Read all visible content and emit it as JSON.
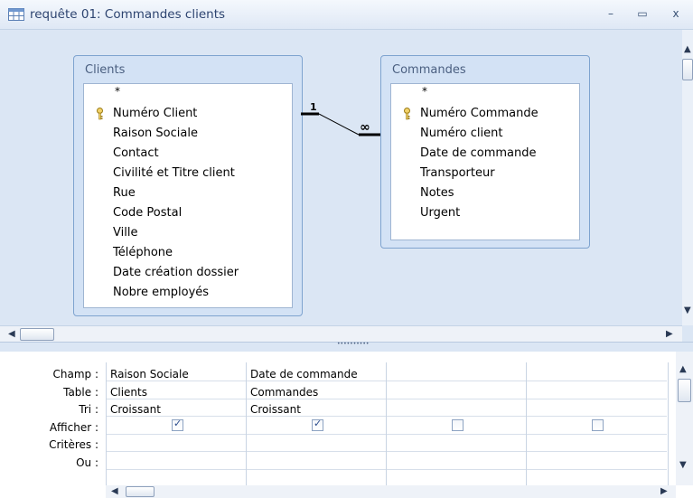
{
  "window": {
    "title": "requête 01: Commandes clients",
    "minimize": "–",
    "maximize": "▭",
    "close": "x"
  },
  "tables": {
    "clients": {
      "title": "Clients",
      "star": "*",
      "fields": [
        "Numéro Client",
        "Raison Sociale",
        "Contact",
        "Civilité et Titre client",
        "Rue",
        "Code Postal",
        "Ville",
        "Téléphone",
        "Date création dossier",
        "Nobre employés"
      ]
    },
    "commandes": {
      "title": "Commandes",
      "star": "*",
      "fields": [
        "Numéro Commande",
        "Numéro client",
        "Date de commande",
        "Transporteur",
        "Notes",
        "Urgent"
      ]
    }
  },
  "relationship": {
    "one": "1",
    "many": "∞"
  },
  "grid": {
    "row_labels": [
      "Champ :",
      "Table :",
      "Tri :",
      "Afficher :",
      "Critères :",
      "Ou :"
    ],
    "columns": [
      {
        "champ": "Raison Sociale",
        "table": "Clients",
        "tri": "Croissant",
        "afficher": true
      },
      {
        "champ": "Date de commande",
        "table": "Commandes",
        "tri": "Croissant",
        "afficher": true
      },
      {
        "champ": "",
        "table": "",
        "tri": "",
        "afficher": false
      },
      {
        "champ": "",
        "table": "",
        "tri": "",
        "afficher": false
      }
    ]
  },
  "splitter": {
    "grip": "••••••••••"
  },
  "icons": [
    "query-icon",
    "key-icon",
    "scroll-left-icon",
    "scroll-right-icon",
    "scroll-up-icon",
    "scroll-down-icon"
  ]
}
